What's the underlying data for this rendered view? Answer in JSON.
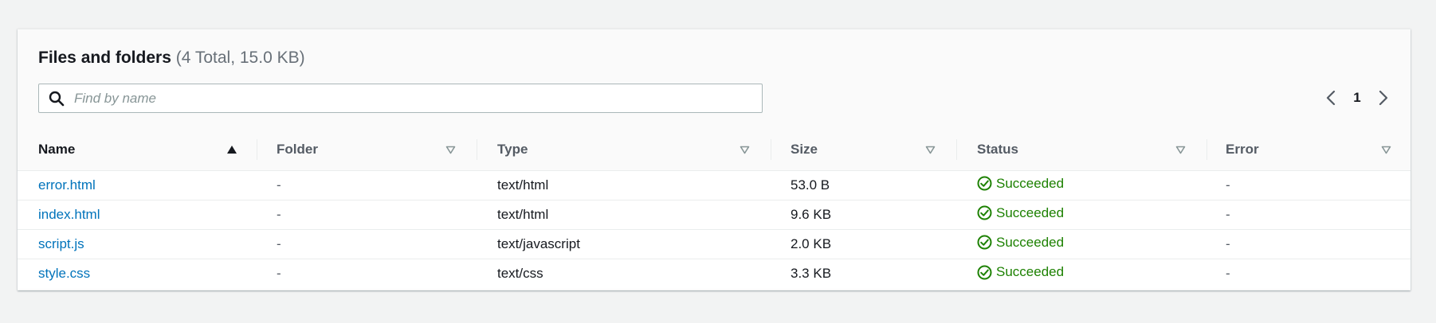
{
  "files_panel": {
    "title": "Files and folders",
    "counter": "(4 Total, 15.0 KB)",
    "search": {
      "placeholder": "Find by name",
      "value": ""
    },
    "pagination": {
      "current_page": "1"
    },
    "columns": [
      {
        "label": "Name",
        "sort": "ascending"
      },
      {
        "label": "Folder",
        "sort": "none"
      },
      {
        "label": "Type",
        "sort": "none"
      },
      {
        "label": "Size",
        "sort": "none"
      },
      {
        "label": "Status",
        "sort": "none"
      },
      {
        "label": "Error",
        "sort": "none"
      }
    ],
    "rows": [
      {
        "name": "error.html",
        "folder": "-",
        "type": "text/html",
        "size": "53.0 B",
        "status": "Succeeded",
        "error": "-"
      },
      {
        "name": "index.html",
        "folder": "-",
        "type": "text/html",
        "size": "9.6 KB",
        "status": "Succeeded",
        "error": "-"
      },
      {
        "name": "script.js",
        "folder": "-",
        "type": "text/javascript",
        "size": "2.0 KB",
        "status": "Succeeded",
        "error": "-"
      },
      {
        "name": "style.css",
        "folder": "-",
        "type": "text/css",
        "size": "3.3 KB",
        "status": "Succeeded",
        "error": "-"
      }
    ]
  },
  "icons": {
    "search": "search-icon",
    "prev_page": "chevron-left-icon",
    "next_page": "chevron-right-icon",
    "sorted_ascending": "caret-up-filled-icon",
    "sortable": "caret-down-outline-icon",
    "status_success": "check-circle-icon"
  },
  "colors": {
    "link": "#0073bb",
    "success": "#1d8102",
    "text": "#16191f",
    "secondary_text": "#687078",
    "background": "#f2f3f3"
  }
}
